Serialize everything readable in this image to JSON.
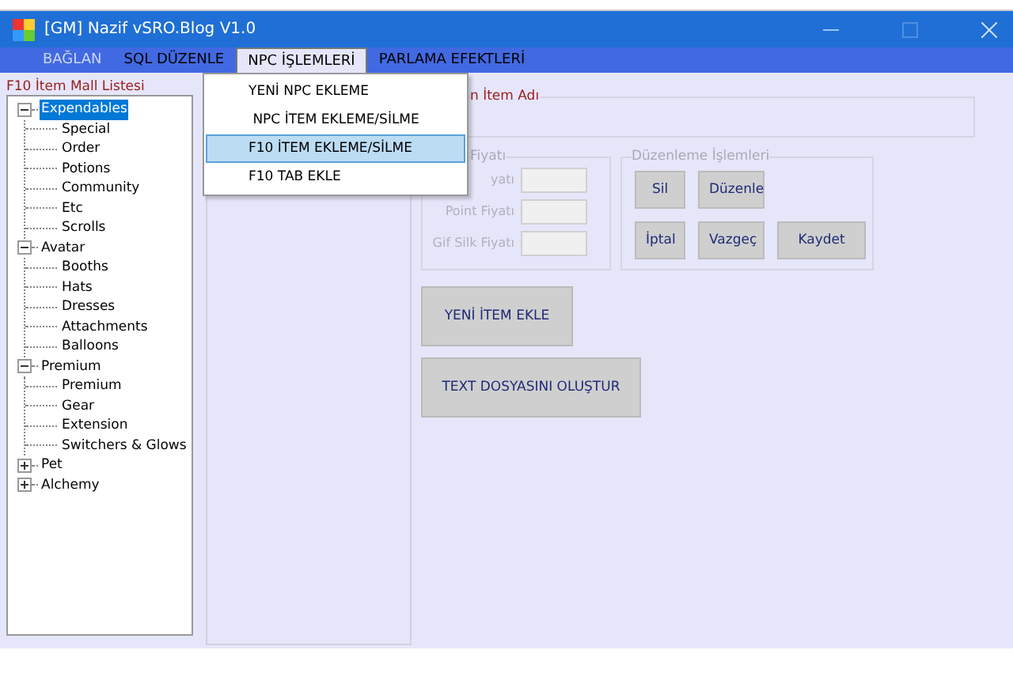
{
  "window": {
    "title": "[GM] Nazif vSRO.Blog V1.0"
  },
  "menu": [
    {
      "label": "BAĞLAN",
      "disabled": true,
      "selected": false
    },
    {
      "label": "SQL DÜZENLE",
      "disabled": false,
      "selected": false
    },
    {
      "label": "NPC İŞLEMLERİ",
      "disabled": false,
      "selected": true
    },
    {
      "label": "PARLAMA EFEKTLERİ",
      "disabled": false,
      "selected": false
    }
  ],
  "dropdown": [
    {
      "label": "YENİ NPC EKLEME",
      "selected": false
    },
    {
      "label": " NPC İTEM EKLEME/SİLME",
      "selected": false
    },
    {
      "label": "F10 İTEM EKLEME/SİLME",
      "selected": true
    },
    {
      "label": "F10 TAB EKLE",
      "selected": false
    }
  ],
  "tree_group": {
    "title": "F10 İtem Mall Listesi",
    "items": [
      {
        "label": "Expendables",
        "expanded": true,
        "selected": true,
        "children": [
          {
            "label": "Special"
          },
          {
            "label": "Order"
          },
          {
            "label": "Potions"
          },
          {
            "label": "Community"
          },
          {
            "label": "Etc"
          },
          {
            "label": "Scrolls"
          }
        ]
      },
      {
        "label": "Avatar",
        "expanded": true,
        "selected": false,
        "children": [
          {
            "label": "Booths"
          },
          {
            "label": "Hats"
          },
          {
            "label": "Dresses"
          },
          {
            "label": "Attachments"
          },
          {
            "label": "Balloons"
          }
        ]
      },
      {
        "label": "Premium",
        "expanded": true,
        "selected": false,
        "children": [
          {
            "label": "Premium"
          },
          {
            "label": "Gear"
          },
          {
            "label": "Extension"
          },
          {
            "label": "Switchers & Glows"
          }
        ]
      },
      {
        "label": "Pet",
        "expanded": false,
        "selected": false
      },
      {
        "label": "Alchemy",
        "expanded": false,
        "selected": false
      }
    ]
  },
  "name_group": {
    "title": "n İtem Adı"
  },
  "price_group": {
    "title": "Fiyatı",
    "fields": [
      {
        "label": "yatı"
      },
      {
        "label": "Point Fiyatı"
      },
      {
        "label": "Gif Silk Fiyatı"
      }
    ]
  },
  "edit_group": {
    "title": "Düzenleme İşlemleri",
    "rows": [
      [
        "Sil",
        "Düzenle"
      ],
      [
        "İptal",
        "Vazgeç",
        "Kaydet"
      ]
    ]
  },
  "actions": [
    "YENİ İTEM EKLE",
    "TEXT DOSYASINI OLUŞTUR"
  ]
}
